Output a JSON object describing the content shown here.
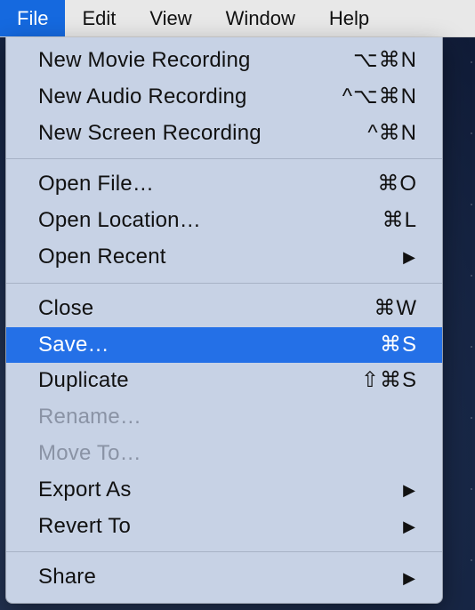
{
  "menubar": {
    "items": [
      {
        "label": "File",
        "active": true
      },
      {
        "label": "Edit",
        "active": false
      },
      {
        "label": "View",
        "active": false
      },
      {
        "label": "Window",
        "active": false
      },
      {
        "label": "Help",
        "active": false
      }
    ]
  },
  "dropdown": {
    "groups": [
      [
        {
          "label": "New Movie Recording",
          "shortcut": "⌥⌘N",
          "enabled": true,
          "submenu": false,
          "highlighted": false
        },
        {
          "label": "New Audio Recording",
          "shortcut": "^⌥⌘N",
          "enabled": true,
          "submenu": false,
          "highlighted": false
        },
        {
          "label": "New Screen Recording",
          "shortcut": "^⌘N",
          "enabled": true,
          "submenu": false,
          "highlighted": false
        }
      ],
      [
        {
          "label": "Open File…",
          "shortcut": "⌘O",
          "enabled": true,
          "submenu": false,
          "highlighted": false
        },
        {
          "label": "Open Location…",
          "shortcut": "⌘L",
          "enabled": true,
          "submenu": false,
          "highlighted": false
        },
        {
          "label": "Open Recent",
          "shortcut": "",
          "enabled": true,
          "submenu": true,
          "highlighted": false
        }
      ],
      [
        {
          "label": "Close",
          "shortcut": "⌘W",
          "enabled": true,
          "submenu": false,
          "highlighted": false
        },
        {
          "label": "Save…",
          "shortcut": "⌘S",
          "enabled": true,
          "submenu": false,
          "highlighted": true
        },
        {
          "label": "Duplicate",
          "shortcut": "⇧⌘S",
          "enabled": true,
          "submenu": false,
          "highlighted": false
        },
        {
          "label": "Rename…",
          "shortcut": "",
          "enabled": false,
          "submenu": false,
          "highlighted": false
        },
        {
          "label": "Move To…",
          "shortcut": "",
          "enabled": false,
          "submenu": false,
          "highlighted": false
        },
        {
          "label": "Export As",
          "shortcut": "",
          "enabled": true,
          "submenu": true,
          "highlighted": false
        },
        {
          "label": "Revert To",
          "shortcut": "",
          "enabled": true,
          "submenu": true,
          "highlighted": false
        }
      ],
      [
        {
          "label": "Share",
          "shortcut": "",
          "enabled": true,
          "submenu": true,
          "highlighted": false
        }
      ]
    ]
  }
}
